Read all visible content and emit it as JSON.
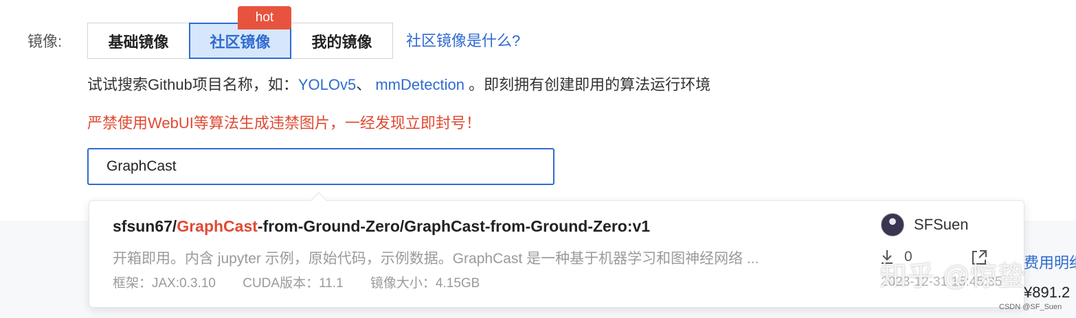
{
  "mirror_label": "镜像:",
  "tabs": [
    {
      "label": "基础镜像",
      "active": false
    },
    {
      "label": "社区镜像",
      "active": true
    },
    {
      "label": "我的镜像",
      "active": false
    }
  ],
  "hot_badge": "hot",
  "what_link": "社区镜像是什么?",
  "hint": {
    "prefix": "试试搜索Github项目名称，如：",
    "link1": "YOLOv5",
    "sep": "、",
    "link2": "mmDetection",
    "suffix": "。即刻拥有创建即用的算法运行环境"
  },
  "warning": "严禁使用WebUI等算法生成违禁图片，一经发现立即封号！",
  "search": {
    "value": "GraphCast"
  },
  "result": {
    "title_prefix": "sfsun67/",
    "title_highlight": "GraphCast",
    "title_suffix": "-from-Ground-Zero/GraphCast-from-Ground-Zero:v1",
    "description": "开箱即用。内含 jupyter 示例，原始代码，示例数据。GraphCast 是一种基于机器学习和图神经网络 ...",
    "framework": "框架：JAX:0.3.10",
    "cuda": "CUDA版本：11.1",
    "size": "镜像大小：4.15GB",
    "author": "SFSuen",
    "downloads": "0",
    "date": "2023-12-31 15:45:35"
  },
  "background": {
    "fee_link": "费用明细",
    "price": "¥891.2"
  },
  "watermark": "知乎 @惊蛰",
  "credit": "CSDN @SF_Suen",
  "colors": {
    "accent": "#2f6bd0",
    "danger": "#e04a32",
    "hot": "#e8533f"
  }
}
